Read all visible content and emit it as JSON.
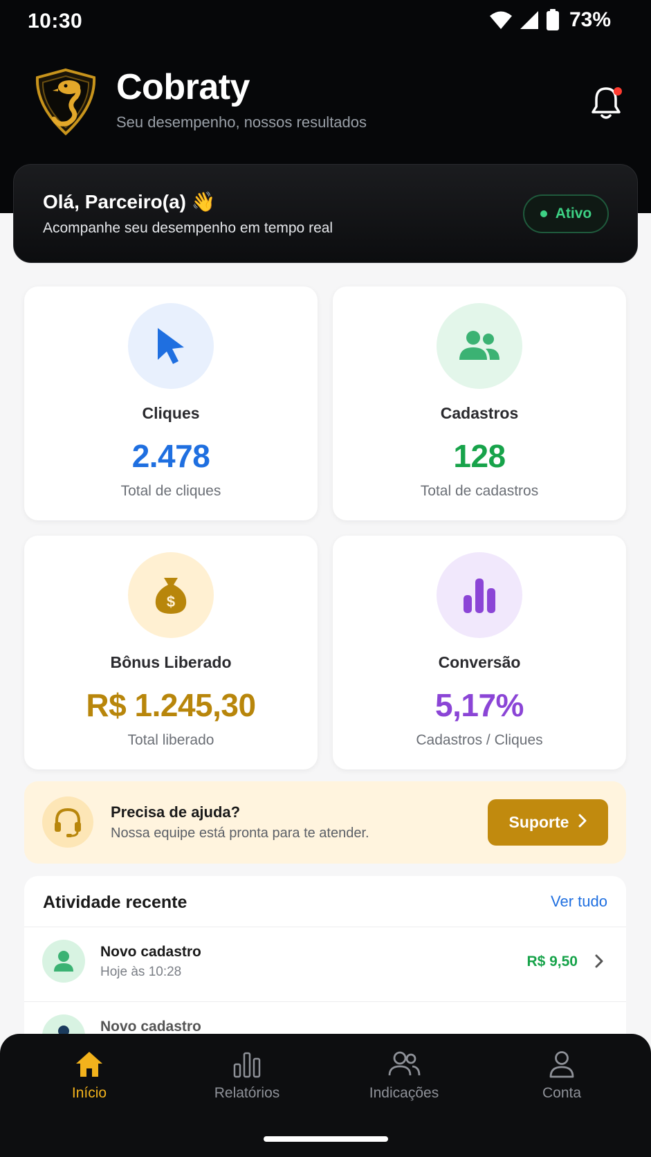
{
  "status_bar": {
    "time": "10:30",
    "battery": "73%",
    "icons": [
      "wifi-icon",
      "signal-icon",
      "battery-icon"
    ]
  },
  "app": {
    "name": "Cobraty",
    "tagline": "Seu desempenho, nossos resultados",
    "logo": "cobra-shield-logo",
    "notification_icon": "bell-icon"
  },
  "welcome": {
    "greeting": "Olá, Parceiro(a) 👋",
    "subtitle": "Acompanhe seu desempenho em tempo real",
    "status": "Ativo"
  },
  "stats": [
    {
      "label": "Cliques",
      "value": "2.478",
      "description": "Total de cliques",
      "icon": "cursor-icon",
      "color": "#1f6fe0",
      "icon_bg": "#e8f0fd"
    },
    {
      "label": "Cadastros",
      "value": "128",
      "description": "Total de cadastros",
      "icon": "users-icon",
      "color": "#17a34a",
      "icon_bg": "#e3f6ea"
    },
    {
      "label": "Bônus Liberado",
      "value": "R$ 1.245,30",
      "description": "Total liberado",
      "icon": "money-bag-icon",
      "color": "#b8860b",
      "icon_bg": "#fff0d2"
    },
    {
      "label": "Conversão",
      "value": "5,17%",
      "description": "Cadastros / Cliques",
      "icon": "bar-chart-icon",
      "color": "#8b45d6",
      "icon_bg": "#f1e8fc"
    }
  ],
  "help": {
    "title": "Precisa de ajuda?",
    "subtitle": "Nossa equipe está pronta para te atender.",
    "button_label": "Suporte",
    "icon": "headset-icon"
  },
  "activity": {
    "title": "Atividade recente",
    "see_all": "Ver tudo",
    "items": [
      {
        "title": "Novo cadastro",
        "time": "Hoje às 10:28",
        "amount": "R$ 9,50"
      },
      {
        "title": "Novo cadastro",
        "time": "",
        "amount": ""
      }
    ]
  },
  "nav": {
    "items": [
      {
        "label": "Início",
        "icon": "home-icon",
        "active": true
      },
      {
        "label": "Relatórios",
        "icon": "bar-chart-icon",
        "active": false
      },
      {
        "label": "Indicações",
        "icon": "users-icon",
        "active": false
      },
      {
        "label": "Conta",
        "icon": "user-icon",
        "active": false
      }
    ]
  },
  "colors": {
    "accent": "#f2b21c",
    "brand_gold": "#c18a0e",
    "success": "#17a34a",
    "link": "#1f6fe0"
  }
}
